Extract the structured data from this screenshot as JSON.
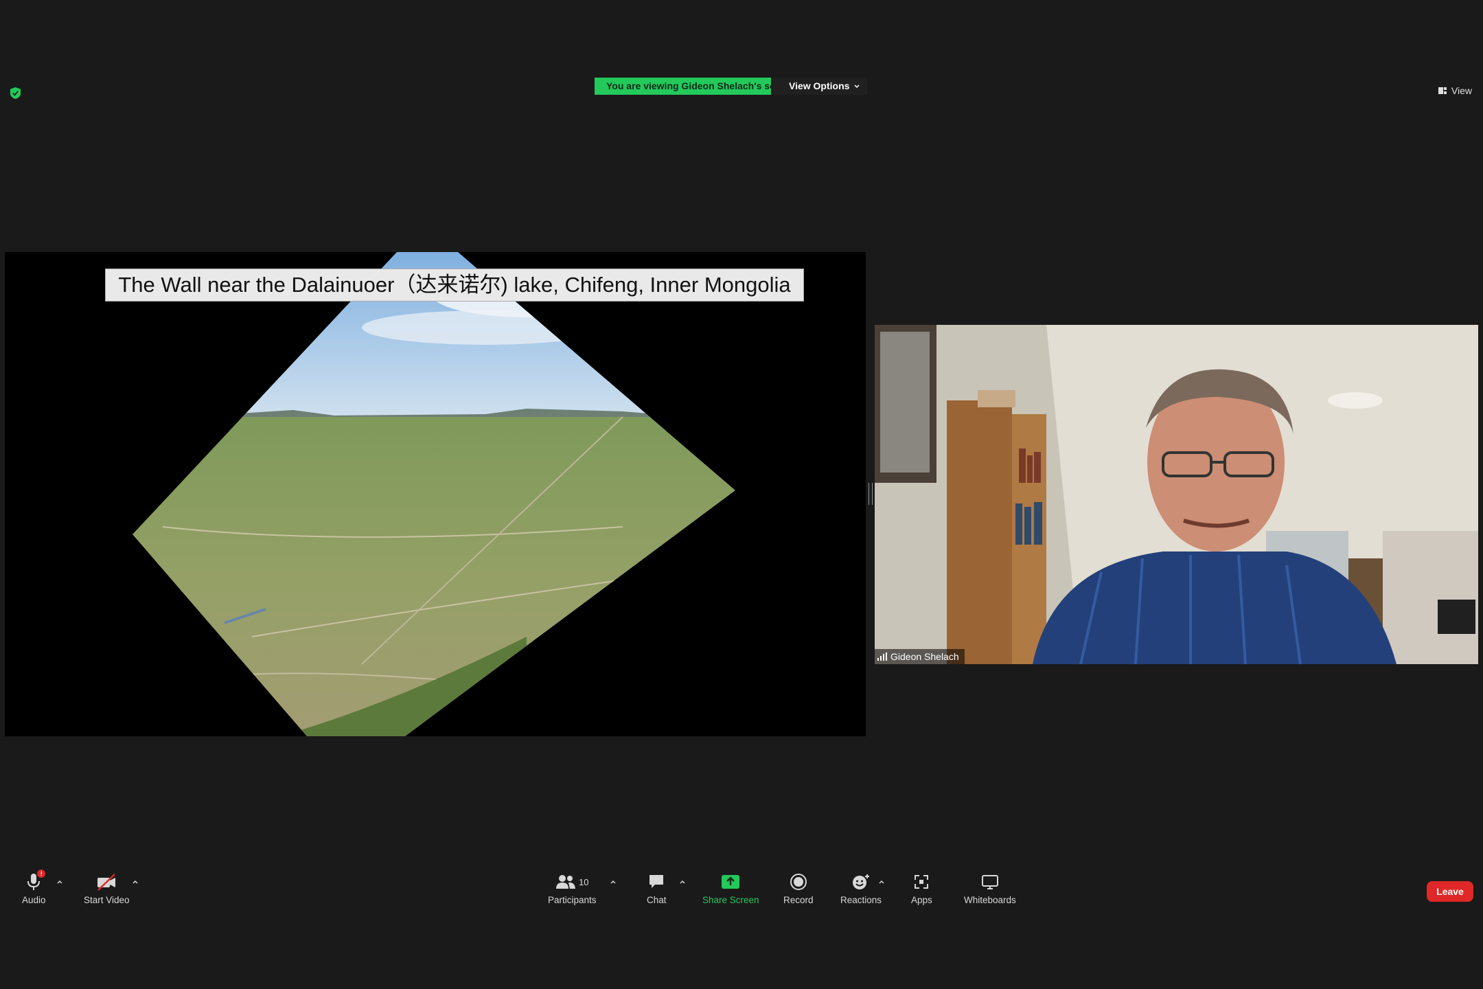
{
  "top": {
    "banner_text": "You are viewing Gideon Shelach's screen",
    "view_options_label": "View Options",
    "view_label": "View"
  },
  "shared_screen": {
    "slide_title": "The Wall near the Dalainuoer（达来诺尔) lake, Chifeng, Inner Mongolia"
  },
  "video": {
    "participant_name": "Gideon Shelach"
  },
  "toolbar": {
    "audio_label": "Audio",
    "start_video_label": "Start Video",
    "participants_label": "Participants",
    "participants_count": "10",
    "chat_label": "Chat",
    "share_screen_label": "Share Screen",
    "record_label": "Record",
    "reactions_label": "Reactions",
    "apps_label": "Apps",
    "whiteboards_label": "Whiteboards",
    "leave_label": "Leave"
  },
  "colors": {
    "accent_green": "#23c95b",
    "leave_red": "#e02828",
    "background": "#1a1a1a"
  },
  "icons": [
    "shield-icon",
    "view-icon",
    "microphone-icon",
    "video-off-icon",
    "participants-icon",
    "chat-icon",
    "share-screen-icon",
    "record-icon",
    "reactions-icon",
    "apps-icon",
    "whiteboard-icon",
    "signal-icon"
  ]
}
